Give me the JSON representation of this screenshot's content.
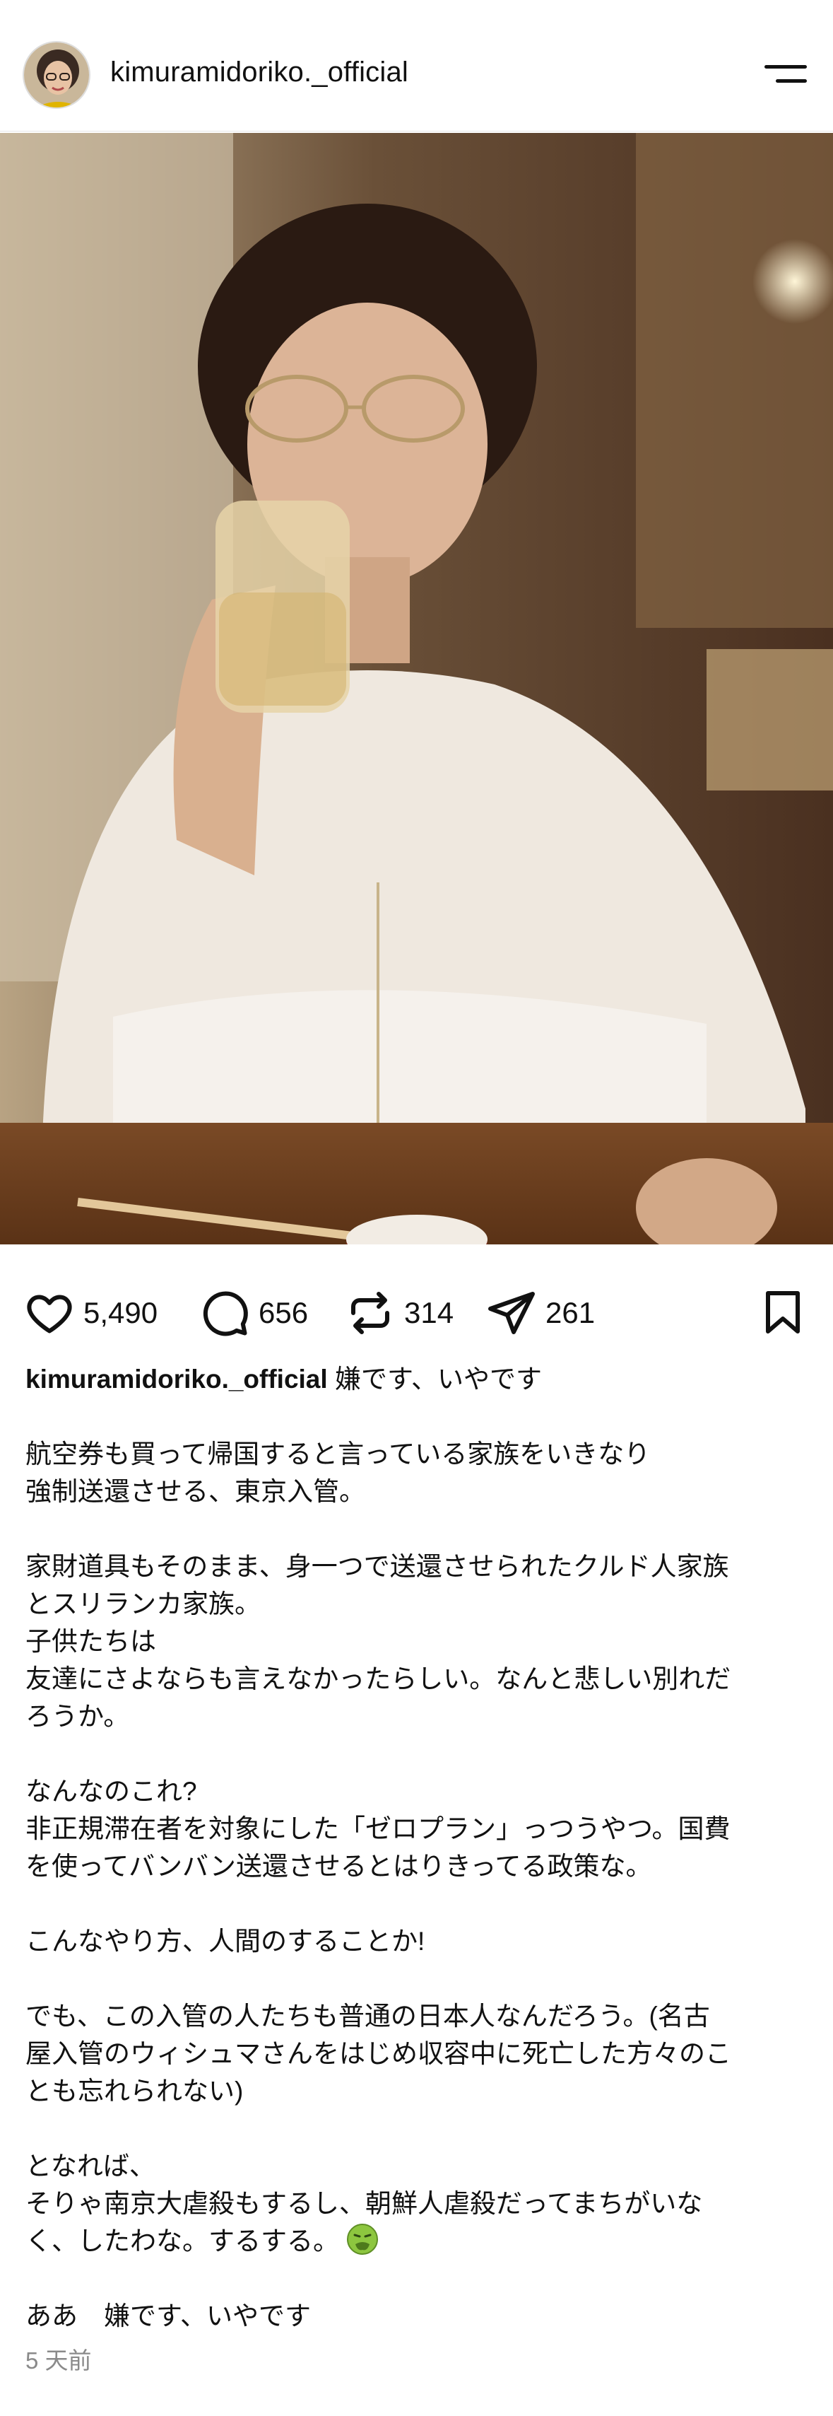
{
  "header": {
    "username": "kimuramidoriko._official",
    "avatar_icon": "profile-avatar",
    "menu_icon": "hamburger-menu-icon"
  },
  "post": {
    "image_description_icon": "photo",
    "stats": {
      "likes": "5,490",
      "comments": "656",
      "reposts": "314",
      "shares": "261"
    },
    "caption": {
      "username": "kimuramidoriko._official",
      "first_line": " 嫌です、いやです",
      "paragraphs": [
        "航空券も買って帰国すると言っている家族をいきなり\n強制送還させる、東京入管。",
        "家財道具もそのまま、身一つで送還させられたクルド人家族\nとスリランカ家族。\n子供たちは\n友達にさよならも言えなかったらしい。なんと悲しい別れだ\nろうか。",
        "なんなのこれ?\n非正規滞在者を対象にした「ゼロプラン」っつうやつ。国費\nを使ってバンバン送還させるとはりきってる政策な。",
        "こんなやり方、人間のすることか!",
        "でも、この入管の人たちも普通の日本人なんだろう。(名古\n屋入管のウィシュマさんをはじめ収容中に死亡した方々のこ\nとも忘れられない)",
        "となれば、\nそりゃ南京大虐殺もするし、朝鮮人虐殺だってまちがいな\nく、したわな。するする。"
      ],
      "last_line": "ああ　嫌です、いやです"
    },
    "timestamp": "5 天前"
  },
  "icons": {
    "like": "heart-icon",
    "comment": "comment-bubble-icon",
    "repost": "repost-arrows-icon",
    "share": "paper-plane-icon",
    "save": "bookmark-icon",
    "nauseated": "nauseated-face-emoji"
  }
}
